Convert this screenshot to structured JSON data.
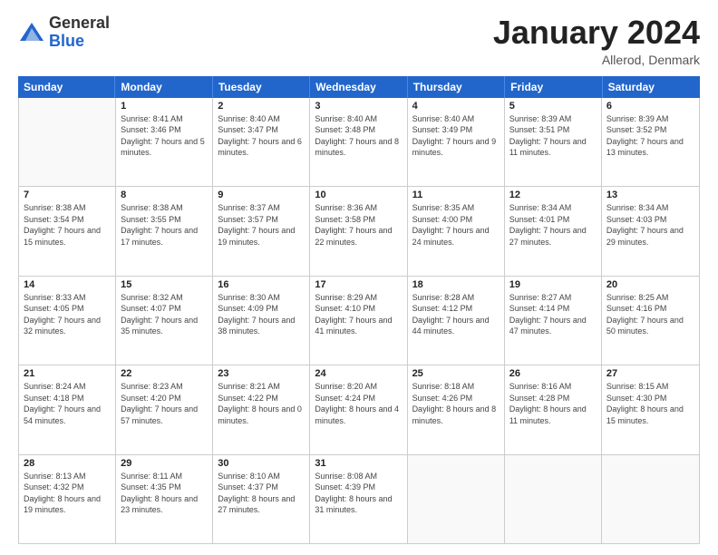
{
  "logo": {
    "general": "General",
    "blue": "Blue"
  },
  "title": "January 2024",
  "location": "Allerod, Denmark",
  "days_of_week": [
    "Sunday",
    "Monday",
    "Tuesday",
    "Wednesday",
    "Thursday",
    "Friday",
    "Saturday"
  ],
  "weeks": [
    [
      {
        "day": "",
        "empty": true
      },
      {
        "day": "1",
        "sunrise": "Sunrise: 8:41 AM",
        "sunset": "Sunset: 3:46 PM",
        "daylight": "Daylight: 7 hours and 5 minutes."
      },
      {
        "day": "2",
        "sunrise": "Sunrise: 8:40 AM",
        "sunset": "Sunset: 3:47 PM",
        "daylight": "Daylight: 7 hours and 6 minutes."
      },
      {
        "day": "3",
        "sunrise": "Sunrise: 8:40 AM",
        "sunset": "Sunset: 3:48 PM",
        "daylight": "Daylight: 7 hours and 8 minutes."
      },
      {
        "day": "4",
        "sunrise": "Sunrise: 8:40 AM",
        "sunset": "Sunset: 3:49 PM",
        "daylight": "Daylight: 7 hours and 9 minutes."
      },
      {
        "day": "5",
        "sunrise": "Sunrise: 8:39 AM",
        "sunset": "Sunset: 3:51 PM",
        "daylight": "Daylight: 7 hours and 11 minutes."
      },
      {
        "day": "6",
        "sunrise": "Sunrise: 8:39 AM",
        "sunset": "Sunset: 3:52 PM",
        "daylight": "Daylight: 7 hours and 13 minutes."
      }
    ],
    [
      {
        "day": "7",
        "sunrise": "Sunrise: 8:38 AM",
        "sunset": "Sunset: 3:54 PM",
        "daylight": "Daylight: 7 hours and 15 minutes."
      },
      {
        "day": "8",
        "sunrise": "Sunrise: 8:38 AM",
        "sunset": "Sunset: 3:55 PM",
        "daylight": "Daylight: 7 hours and 17 minutes."
      },
      {
        "day": "9",
        "sunrise": "Sunrise: 8:37 AM",
        "sunset": "Sunset: 3:57 PM",
        "daylight": "Daylight: 7 hours and 19 minutes."
      },
      {
        "day": "10",
        "sunrise": "Sunrise: 8:36 AM",
        "sunset": "Sunset: 3:58 PM",
        "daylight": "Daylight: 7 hours and 22 minutes."
      },
      {
        "day": "11",
        "sunrise": "Sunrise: 8:35 AM",
        "sunset": "Sunset: 4:00 PM",
        "daylight": "Daylight: 7 hours and 24 minutes."
      },
      {
        "day": "12",
        "sunrise": "Sunrise: 8:34 AM",
        "sunset": "Sunset: 4:01 PM",
        "daylight": "Daylight: 7 hours and 27 minutes."
      },
      {
        "day": "13",
        "sunrise": "Sunrise: 8:34 AM",
        "sunset": "Sunset: 4:03 PM",
        "daylight": "Daylight: 7 hours and 29 minutes."
      }
    ],
    [
      {
        "day": "14",
        "sunrise": "Sunrise: 8:33 AM",
        "sunset": "Sunset: 4:05 PM",
        "daylight": "Daylight: 7 hours and 32 minutes."
      },
      {
        "day": "15",
        "sunrise": "Sunrise: 8:32 AM",
        "sunset": "Sunset: 4:07 PM",
        "daylight": "Daylight: 7 hours and 35 minutes."
      },
      {
        "day": "16",
        "sunrise": "Sunrise: 8:30 AM",
        "sunset": "Sunset: 4:09 PM",
        "daylight": "Daylight: 7 hours and 38 minutes."
      },
      {
        "day": "17",
        "sunrise": "Sunrise: 8:29 AM",
        "sunset": "Sunset: 4:10 PM",
        "daylight": "Daylight: 7 hours and 41 minutes."
      },
      {
        "day": "18",
        "sunrise": "Sunrise: 8:28 AM",
        "sunset": "Sunset: 4:12 PM",
        "daylight": "Daylight: 7 hours and 44 minutes."
      },
      {
        "day": "19",
        "sunrise": "Sunrise: 8:27 AM",
        "sunset": "Sunset: 4:14 PM",
        "daylight": "Daylight: 7 hours and 47 minutes."
      },
      {
        "day": "20",
        "sunrise": "Sunrise: 8:25 AM",
        "sunset": "Sunset: 4:16 PM",
        "daylight": "Daylight: 7 hours and 50 minutes."
      }
    ],
    [
      {
        "day": "21",
        "sunrise": "Sunrise: 8:24 AM",
        "sunset": "Sunset: 4:18 PM",
        "daylight": "Daylight: 7 hours and 54 minutes."
      },
      {
        "day": "22",
        "sunrise": "Sunrise: 8:23 AM",
        "sunset": "Sunset: 4:20 PM",
        "daylight": "Daylight: 7 hours and 57 minutes."
      },
      {
        "day": "23",
        "sunrise": "Sunrise: 8:21 AM",
        "sunset": "Sunset: 4:22 PM",
        "daylight": "Daylight: 8 hours and 0 minutes."
      },
      {
        "day": "24",
        "sunrise": "Sunrise: 8:20 AM",
        "sunset": "Sunset: 4:24 PM",
        "daylight": "Daylight: 8 hours and 4 minutes."
      },
      {
        "day": "25",
        "sunrise": "Sunrise: 8:18 AM",
        "sunset": "Sunset: 4:26 PM",
        "daylight": "Daylight: 8 hours and 8 minutes."
      },
      {
        "day": "26",
        "sunrise": "Sunrise: 8:16 AM",
        "sunset": "Sunset: 4:28 PM",
        "daylight": "Daylight: 8 hours and 11 minutes."
      },
      {
        "day": "27",
        "sunrise": "Sunrise: 8:15 AM",
        "sunset": "Sunset: 4:30 PM",
        "daylight": "Daylight: 8 hours and 15 minutes."
      }
    ],
    [
      {
        "day": "28",
        "sunrise": "Sunrise: 8:13 AM",
        "sunset": "Sunset: 4:32 PM",
        "daylight": "Daylight: 8 hours and 19 minutes."
      },
      {
        "day": "29",
        "sunrise": "Sunrise: 8:11 AM",
        "sunset": "Sunset: 4:35 PM",
        "daylight": "Daylight: 8 hours and 23 minutes."
      },
      {
        "day": "30",
        "sunrise": "Sunrise: 8:10 AM",
        "sunset": "Sunset: 4:37 PM",
        "daylight": "Daylight: 8 hours and 27 minutes."
      },
      {
        "day": "31",
        "sunrise": "Sunrise: 8:08 AM",
        "sunset": "Sunset: 4:39 PM",
        "daylight": "Daylight: 8 hours and 31 minutes."
      },
      {
        "day": "",
        "empty": true
      },
      {
        "day": "",
        "empty": true
      },
      {
        "day": "",
        "empty": true
      }
    ]
  ]
}
